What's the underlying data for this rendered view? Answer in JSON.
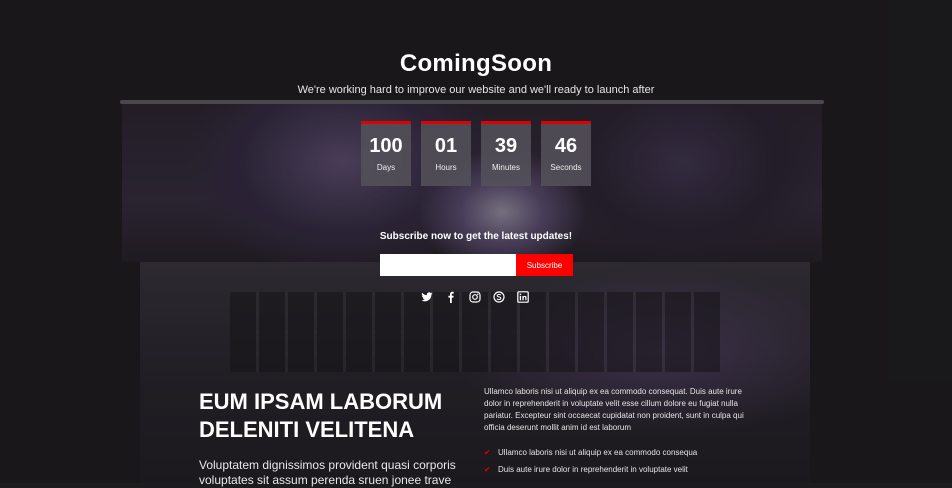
{
  "header": {
    "title": "ComingSoon",
    "subtitle": "We're working hard to improve our website and we'll ready to launch after"
  },
  "countdown": [
    {
      "value": "100",
      "label": "Days"
    },
    {
      "value": "01",
      "label": "Hours"
    },
    {
      "value": "39",
      "label": "Minutes"
    },
    {
      "value": "46",
      "label": "Seconds"
    }
  ],
  "subscribe": {
    "text": "Subscribe now to get the latest updates!",
    "input_value": "",
    "button_label": "Subscribe"
  },
  "social": [
    "twitter-icon",
    "facebook-icon",
    "instagram-icon",
    "skype-icon",
    "linkedin-icon"
  ],
  "about": {
    "headline_line1": "EUM IPSAM LABORUM",
    "headline_line2": "DELENITI VELITENA",
    "lead": "Voluptatem dignissimos provident quasi corporis voluptates sit assum perenda sruen jonee trave",
    "paragraph": "Ullamco laboris nisi ut aliquip ex ea commodo consequat. Duis aute irure dolor in reprehenderit in voluptate velit esse cillum dolore eu fugiat nulla pariatur. Excepteur sint occaecat cupidatat non proident, sunt in culpa qui officia deserunt mollit anim id est laborum",
    "list": [
      "Ullamco laboris nisi ut aliquip ex ea commodo consequa",
      "Duis aute irure dolor in reprehenderit in voluptate velit"
    ]
  },
  "colors": {
    "accent": "#ff0000",
    "background": "#1c1b1e"
  }
}
